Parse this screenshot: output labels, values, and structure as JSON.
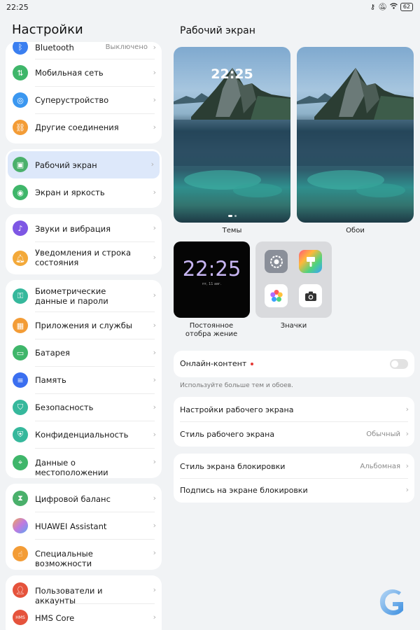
{
  "status_bar": {
    "time": "22:25",
    "battery": "62"
  },
  "left": {
    "title": "Настройки",
    "groups": [
      {
        "items": [
          {
            "label": "Bluetooth",
            "value": "Выключено",
            "icon": "bluetooth-icon",
            "color": "#3b7ff0"
          },
          {
            "label": "Мобильная сеть",
            "icon": "signal-icon",
            "color": "#3fb66a"
          },
          {
            "label": "Суперустройство",
            "icon": "super-device-icon",
            "color": "#3b97f0"
          },
          {
            "label": "Другие соединения",
            "icon": "link-icon",
            "color": "#f39c36"
          }
        ]
      },
      {
        "items": [
          {
            "label": "Рабочий экран",
            "icon": "wallpaper-icon",
            "color": "#4ab06b"
          },
          {
            "label": "Экран и яркость",
            "icon": "eye-icon",
            "color": "#3fb66a"
          }
        ]
      },
      {
        "items": [
          {
            "label": "Звуки и вибрация",
            "icon": "sound-icon",
            "color": "#7e57e4"
          },
          {
            "label": "Уведомления и строка состояния",
            "icon": "bell-icon",
            "color": "#f3a93a"
          }
        ]
      },
      {
        "items": [
          {
            "label": "Биометрические данные и пароли",
            "icon": "key-icon",
            "color": "#36b89c"
          },
          {
            "label": "Приложения и службы",
            "icon": "apps-icon",
            "color": "#f39c36"
          },
          {
            "label": "Батарея",
            "icon": "battery-icon",
            "color": "#3fb66a"
          },
          {
            "label": "Память",
            "icon": "storage-icon",
            "color": "#3b6ff0"
          },
          {
            "label": "Безопасность",
            "icon": "shield-icon",
            "color": "#36b89c"
          },
          {
            "label": "Конфиденциальность",
            "icon": "privacy-icon",
            "color": "#36b89c"
          },
          {
            "label": "Данные о местоположении",
            "icon": "location-icon",
            "color": "#3fb66a"
          }
        ]
      },
      {
        "items": [
          {
            "label": "Цифровой баланс",
            "icon": "hourglass-icon",
            "color": "#4ab06b"
          },
          {
            "label": "HUAWEI Assistant",
            "icon": "assistant-icon",
            "color": "#c07ae0"
          },
          {
            "label": "Специальные возможности",
            "icon": "hand-icon",
            "color": "#f39c36"
          }
        ]
      },
      {
        "items": [
          {
            "label": "Пользователи и аккаунты",
            "icon": "user-icon",
            "color": "#e5533c"
          },
          {
            "label": "HMS Core",
            "icon": "hms-icon",
            "color": "#e5533c",
            "icon_text": "HMS"
          }
        ]
      }
    ]
  },
  "right": {
    "title": "Рабочий экран",
    "themes_caption": "Темы",
    "wallpaper_caption": "Обои",
    "lock_time": "22:25",
    "aod_time": "22:25",
    "aod_date": "пт, 11 авг.",
    "aod_caption": "Постоянное отобра жение",
    "icons_caption": "Значки",
    "online_content": "Онлайн-контент",
    "online_hint": "Используйте больше тем и обоев.",
    "home_settings": "Настройки рабочего экрана",
    "home_style": "Стиль рабочего экрана",
    "home_style_value": "Обычный",
    "lock_style": "Стиль экрана блокировки",
    "lock_style_value": "Альбомная",
    "lock_signature": "Подпись на экране блокировки"
  }
}
